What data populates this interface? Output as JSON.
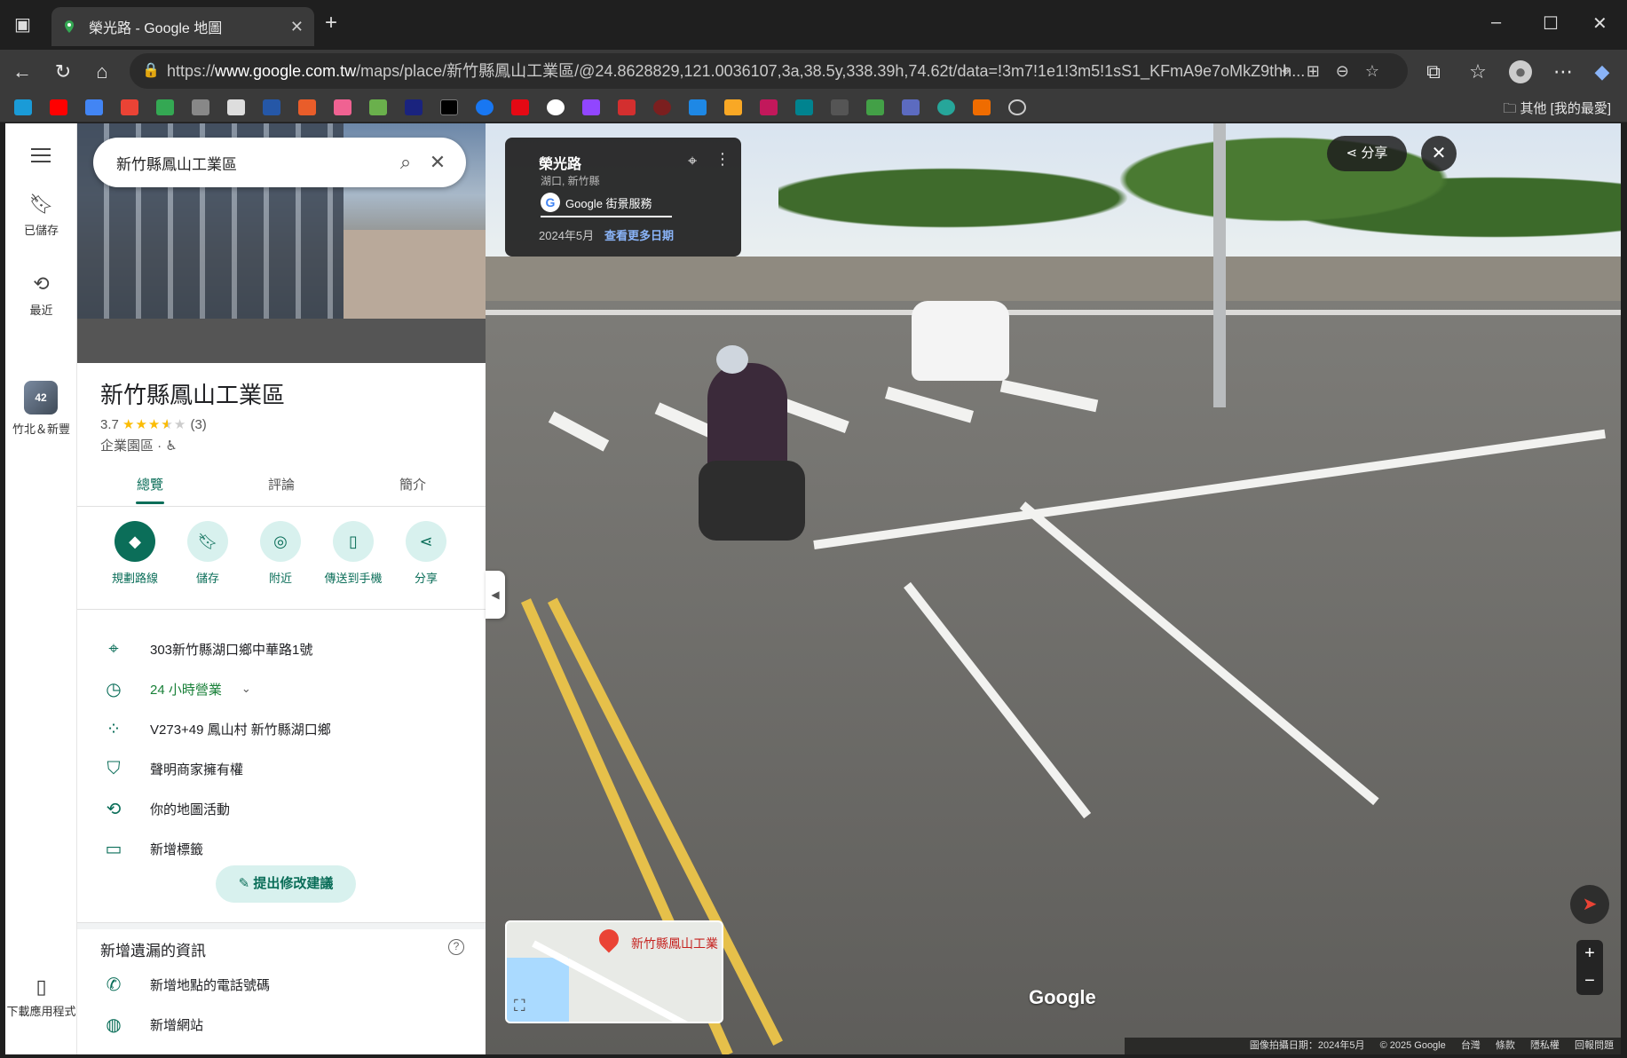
{
  "browser": {
    "tab_title": "榮光路 - Google 地圖",
    "url_prefix": "https://",
    "url_host": "www.google.com.tw",
    "url_path": "/maps/place/新竹縣鳳山工業區/@24.8628829,121.0036107,3a,38.5y,338.39h,74.62t/data=!3m7!1e1!3m5!1sS1_KFmA9e7oMkZ9thh...",
    "bookmarks_other": "其他 [我的最愛]"
  },
  "rail": {
    "saved": "已儲存",
    "recent": "最近",
    "recent_place_badge": "42",
    "recent_place": "竹北＆新豐",
    "download_app": "下載應用程式"
  },
  "search": {
    "value": "新竹縣鳳山工業區"
  },
  "place": {
    "title": "新竹縣鳳山工業區",
    "rating": "3.7",
    "review_count": "(3)",
    "category": "企業園區 · ♿"
  },
  "tabs": [
    {
      "label": "總覽"
    },
    {
      "label": "評論"
    },
    {
      "label": "簡介"
    }
  ],
  "actions": [
    {
      "label": "規劃路線"
    },
    {
      "label": "儲存"
    },
    {
      "label": "附近"
    },
    {
      "label": "傳送到手機"
    },
    {
      "label": "分享"
    }
  ],
  "info": {
    "address": "303新竹縣湖口鄉中華路1號",
    "hours": "24 小時營業",
    "plus_code": "V273+49 鳳山村 新竹縣湖口鄉",
    "claim": "聲明商家擁有權",
    "activity": "你的地圖活動",
    "add_label": "新增標籤"
  },
  "suggest_edit": "提出修改建議",
  "missing": {
    "title": "新增遺漏的資訊",
    "add_phone": "新增地點的電話號碼",
    "add_website": "新增網站"
  },
  "streetview": {
    "road_name": "榮光路",
    "location": "湖口, 新竹縣",
    "service": "Google 街景服務",
    "date": "2024年5月",
    "more_dates": "查看更多日期",
    "share": "分享",
    "minimap_label": "新竹縣鳳山工業",
    "logo": "Google",
    "footer_date": "圖像拍攝日期：2024年5月",
    "footer_copyright": "© 2025 Google",
    "footer_links": [
      "台灣",
      "條款",
      "隱私權",
      "回報問題"
    ]
  }
}
